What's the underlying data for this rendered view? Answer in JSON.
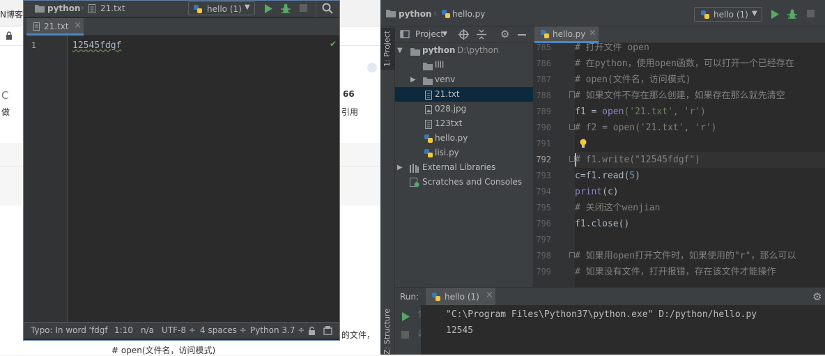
{
  "browser": {
    "tab_fragment": "N博客",
    "side_fragment_1": "C",
    "side_fragment_2": "做",
    "right_fragment_1": "66",
    "right_fragment_2": "引用",
    "bottom_line_1": "的文件，",
    "bottom_line_2": "# open(文件名，访问模式)"
  },
  "small_editor": {
    "breadcrumb_project": "python",
    "breadcrumb_file": "21.txt",
    "run_config": "hello (1)",
    "tab_label": "21.txt",
    "line_numbers": [
      "1"
    ],
    "content": "12545fdgf",
    "status": {
      "typo": "Typo: In word 'fdgf",
      "position": "1:10",
      "na": "n/a",
      "encoding": "UTF-8 ÷",
      "indent": "4 spaces ÷",
      "interpreter": "Python 3.7 ÷"
    }
  },
  "ide": {
    "breadcrumb_project": "python",
    "breadcrumb_file": "hello.py",
    "run_config": "hello (1)",
    "left_tool_label": "1: Project",
    "project_dropdown": "Project",
    "editor_tab": "hello.py",
    "tree": [
      {
        "label": "python",
        "extra": "D:\\python",
        "icon": "folder-icon"
      },
      {
        "label": "llll",
        "icon": "folder-icon"
      },
      {
        "label": "venv",
        "icon": "folder-icon"
      },
      {
        "label": "21.txt",
        "icon": "text-file-icon"
      },
      {
        "label": "028.jpg",
        "icon": "image-file-icon"
      },
      {
        "label": "123txt",
        "icon": "text-file-icon"
      },
      {
        "label": "hello.py",
        "icon": "python-file-icon"
      },
      {
        "label": "lisi.py",
        "icon": "python-file-icon"
      },
      {
        "label": "External Libraries",
        "icon": "library-icon"
      },
      {
        "label": "Scratches and Consoles",
        "icon": "scratch-icon"
      }
    ],
    "line_numbers": [
      "785",
      "786",
      "787",
      "788",
      "789",
      "790",
      "791",
      "792",
      "793",
      "794",
      "795",
      "796",
      "797",
      "798",
      "799"
    ],
    "code": {
      "l785": "# 打开文件 open",
      "l786": "# 在python，使用open函数，可以打开一个已经存在",
      "l787": "# open(文件名，访问模式)",
      "l788": "# 如果文件不存在那么创建，如果存在那么就先清空",
      "l789a": "f1 = ",
      "l789b": "open",
      "l789c": "('21.txt', 'r')",
      "l790": "# f2 = open('21.txt', 'r')",
      "l792": "# f1.write(\"12545fdgf\")",
      "l793a": "c=f1.read(",
      "l793b": "5",
      "l793c": ")",
      "l794a": "print",
      "l794b": "(c)",
      "l795": "# 关闭这个wenjian",
      "l796": "f1.close()",
      "l798": "# 如果用open打开文件时，如果使用的\"r\"，那么可以",
      "l799": "# 如果没有文件，打开报错，存在该文件才能操作"
    },
    "run_label": "Run:",
    "run_tab": "hello (1)",
    "structure_label": "Z: Structure",
    "output": [
      "\"C:\\Program Files\\Python37\\python.exe\" D:/python/hello.py",
      "12545"
    ]
  }
}
